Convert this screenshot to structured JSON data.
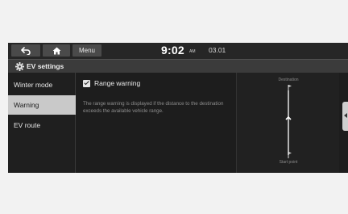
{
  "topbar": {
    "menu_label": "Menu",
    "time": "9:02",
    "ampm": "AM",
    "date": "03.01",
    "back_icon": "back-arrow-icon",
    "home_icon": "home-icon"
  },
  "titlebar": {
    "title": "EV settings",
    "icon": "gear-icon"
  },
  "sidebar": {
    "items": [
      {
        "label": "Winter mode"
      },
      {
        "label": "Warning"
      },
      {
        "label": "EV route"
      }
    ],
    "selected": "Warning"
  },
  "content": {
    "range_warning_label": "Range warning",
    "range_warning_checked": true,
    "description": "The range warning is displayed if the distance to the destination exceeds the available vehicle range."
  },
  "diagram": {
    "destination_label": "Destination",
    "start_label": "Start point"
  },
  "colors": {
    "screen_bg": "#1d1d1d",
    "selected_item_bg": "#c9c9c9",
    "titlebar_bg": "#3b3b3b"
  }
}
